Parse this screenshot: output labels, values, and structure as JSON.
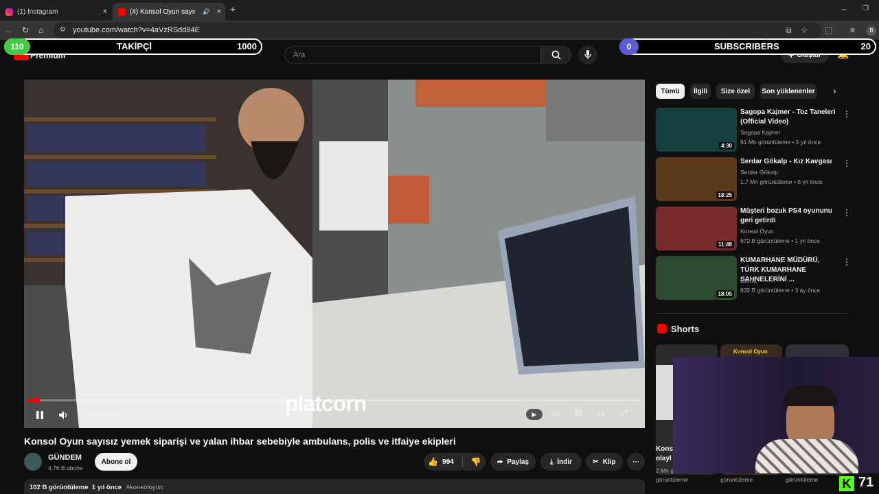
{
  "browser": {
    "tabs": [
      {
        "label": "(1) Instagram",
        "close": "×"
      },
      {
        "label": "(4) Konsol Oyun sayısız yem",
        "close": "×"
      }
    ],
    "new_tab": "+",
    "url": "youtube.com/watch?v=4aVzRSdd84E",
    "window_min": "–",
    "window_restore": "❐"
  },
  "youtube": {
    "logo_text": "Premium",
    "logo_region": "TR",
    "search_placeholder": "Ara",
    "create_label": "Oluştur",
    "notif_count": "4",
    "avatar_letter": "B"
  },
  "overlay": {
    "followers_label": "TAKİPÇİ",
    "followers_current": "110",
    "followers_goal": "1000",
    "subs_label": "SUBSCRIBERS",
    "subs_current": "0",
    "subs_goal": "20"
  },
  "player": {
    "time": "0:02 / 2:16",
    "watermark": "platcorn",
    "progress_fraction": 0.015
  },
  "video": {
    "title": "Konsol Oyun sayısız yemek siparişi ve yalan ihbar sebebiyle ambulans, polis ve itfaiye ekipleri",
    "channel": "GÜNDEM",
    "subs": "4,76 B abone",
    "subscribe": "Abone ol",
    "likes": "994",
    "share": "Paylaş",
    "download": "İndir",
    "clip": "Klip",
    "description_meta": "102 B görüntüleme  1 yıl önce",
    "description_tag": "#konsoloyun"
  },
  "chips": [
    "Tümü",
    "İlgili",
    "Size özel",
    "Son yüklenenler"
  ],
  "recommendations": [
    {
      "title": "Sagopa Kajmer - Toz Taneleri (Official Video)",
      "channel": "Sagopa Kajmer",
      "meta": "91 Mn görüntüleme • 5 yıl önce",
      "duration": "4:30",
      "color": "#153f3e"
    },
    {
      "title": "Serdar Gökalp - Kız Kavgası",
      "channel": "Serdar Gökalp",
      "meta": "1,7 Mn görüntüleme • 6 yıl önce",
      "duration": "18:25",
      "color": "#5a3a1a"
    },
    {
      "title": "Müşteri bozuk PS4 oyununu geri getirdi",
      "channel": "Konsol Oyun",
      "meta": "672 B görüntüleme • 1 yıl önce",
      "duration": "11:48",
      "color": "#7a2a2a"
    },
    {
      "title": "KUMARHANE MÜDÜRÜ, TÜRK KUMARHANE SAHNELERİNİ ...",
      "channel": "Literat",
      "meta": "832 B görüntüleme • 3 ay önce",
      "duration": "18:05",
      "color": "#2e4a2e"
    }
  ],
  "shorts": {
    "label": "Shorts",
    "items": [
      {
        "title": "Kons olayl",
        "meta": "2 Mn görüntüleme"
      },
      {
        "badge": "Konsol Oyun",
        "meta": "görüntüleme"
      },
      {
        "meta": "görüntüleme"
      }
    ]
  },
  "kick": {
    "logo": "K",
    "viewers": "71"
  }
}
